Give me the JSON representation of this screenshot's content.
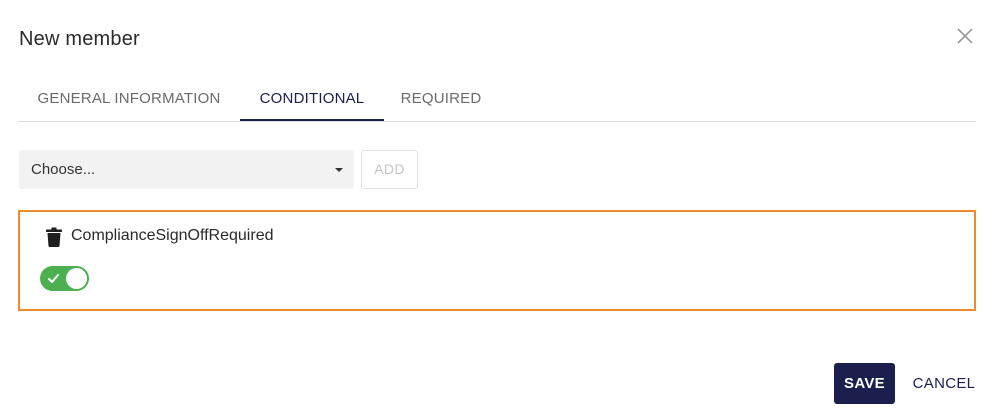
{
  "dialog": {
    "title": "New member",
    "close_icon": "close-icon"
  },
  "tabs": [
    {
      "label": "GENERAL INFORMATION",
      "active": false
    },
    {
      "label": "CONDITIONAL",
      "active": true
    },
    {
      "label": "REQUIRED",
      "active": false
    }
  ],
  "condition_picker": {
    "select_value": "Choose...",
    "add_label": "ADD",
    "add_enabled": false
  },
  "conditions": [
    {
      "name": "ComplianceSignOffRequired",
      "delete_icon": "trash-icon",
      "enabled": true
    }
  ],
  "footer": {
    "save_label": "SAVE",
    "cancel_label": "CANCEL"
  },
  "colors": {
    "primary": "#1b1f4d",
    "highlight_border": "#f08a2e",
    "toggle_on": "#4caf50"
  }
}
